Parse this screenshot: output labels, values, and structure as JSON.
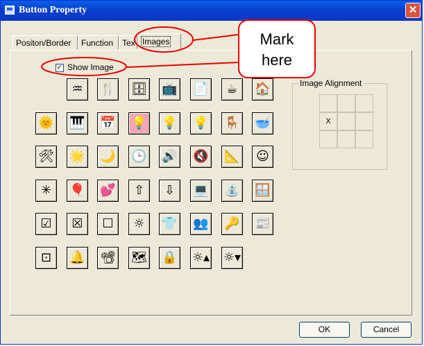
{
  "window": {
    "title": "Button Property",
    "close_glyph": "✕"
  },
  "tabs": [
    {
      "label": "Positon/Border"
    },
    {
      "label": "Function"
    },
    {
      "label": "Tex"
    },
    {
      "label": "Images",
      "active": true
    }
  ],
  "show_image": {
    "label": "Show Image",
    "checked": true,
    "check_glyph": "✓"
  },
  "image_grid": {
    "rows": [
      [
        "",
        "♒",
        "🍴",
        "🗄",
        "📺",
        "📄",
        "☕",
        "🏠"
      ],
      [
        "🌞",
        "🎹",
        "📅",
        "💡",
        "💡",
        "💡",
        "🪑",
        "🥣"
      ],
      [
        "🛠",
        "🌟",
        "🌙",
        "🕒",
        "🔊",
        "🔇",
        "📐",
        "☺"
      ],
      [
        "✳",
        "🎈",
        "💕",
        "⇧",
        "⇩",
        "💻",
        "⛲",
        "🪟"
      ],
      [
        "☑",
        "☒",
        "☐",
        "☼",
        "👕",
        "👥",
        "🔑",
        "📰"
      ],
      [
        "⊡",
        "🔔",
        "📽",
        "🗺",
        "🔒",
        "☼▴",
        "☼▾",
        ""
      ]
    ],
    "selected": {
      "row": 1,
      "col": 3
    }
  },
  "image_alignment": {
    "title": "Image Alignment",
    "cells": [
      [
        "",
        "",
        ""
      ],
      [
        "X",
        "",
        ""
      ],
      [
        "",
        "",
        ""
      ]
    ]
  },
  "buttons": {
    "ok": "OK",
    "cancel": "Cancel"
  },
  "annotation": {
    "text_line1": "Mark",
    "text_line2": "here",
    "color": "#e00000"
  },
  "colors": {
    "title_bar": "#0a3fd0",
    "dialog_bg": "#ece9d8",
    "selected_icon_bg": "#f4a6b6"
  }
}
